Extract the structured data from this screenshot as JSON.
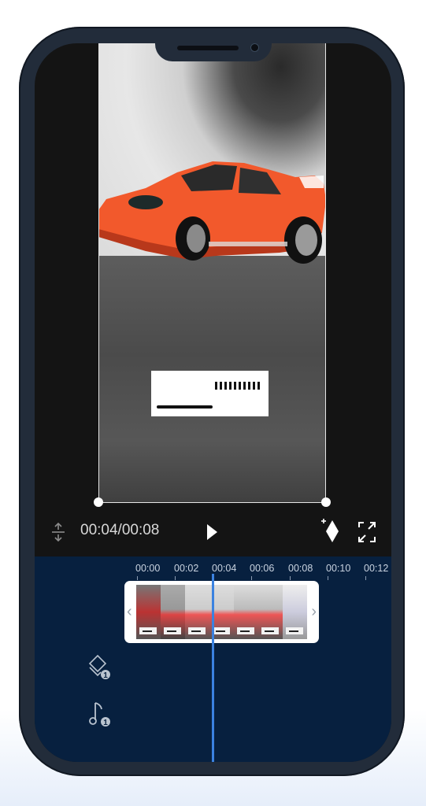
{
  "player": {
    "time_display": "00:04/00:08",
    "current_time": "00:04",
    "duration": "00:08"
  },
  "timeline": {
    "ruler_labels": [
      "00:00",
      "00:02",
      "00:04",
      "00:06",
      "00:08",
      "00:10",
      "00:12"
    ],
    "overlay_layer_count": "1",
    "audio_layer_count": "1"
  },
  "icons": {
    "split": "split-vertical-arrows-icon",
    "play": "play-icon",
    "keyframe": "keyframe-add-icon",
    "fullscreen": "fullscreen-icon",
    "overlay": "layers-icon",
    "audio": "music-note-icon"
  },
  "colors": {
    "timeline_bg": "#07203f",
    "playhead": "#3b82e0",
    "phone_frame": "#222c3a",
    "car": "#f2592c"
  }
}
